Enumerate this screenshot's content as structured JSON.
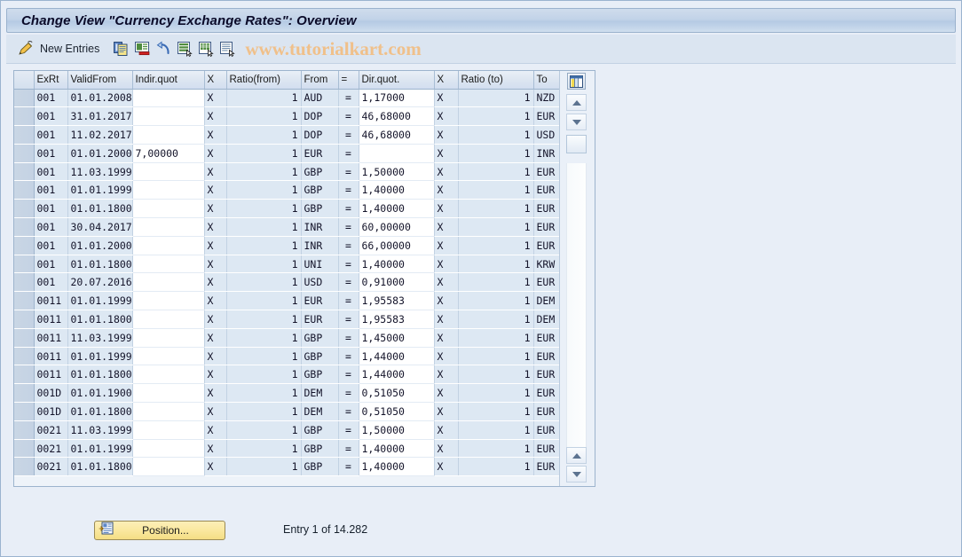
{
  "window": {
    "title": "Change View \"Currency Exchange Rates\": Overview"
  },
  "toolbar": {
    "pencil_icon": "pencil-icon",
    "new_entries_label": "New Entries",
    "buttons": [
      {
        "name": "copy-as-icon",
        "title": "Copy As..."
      },
      {
        "name": "delete-icon",
        "title": "Delete"
      },
      {
        "name": "undo-icon",
        "title": "Undo Change"
      },
      {
        "name": "select-all-icon",
        "title": "Select All"
      },
      {
        "name": "select-block-icon",
        "title": "Select Block"
      },
      {
        "name": "deselect-all-icon",
        "title": "Deselect All"
      }
    ],
    "watermark": "www.tutorialkart.com"
  },
  "grid": {
    "columns": [
      {
        "key": "exrt",
        "label": "ExRt"
      },
      {
        "key": "valid",
        "label": "ValidFrom"
      },
      {
        "key": "indir",
        "label": "Indir.quot"
      },
      {
        "key": "x1",
        "label": "X"
      },
      {
        "key": "rfrom",
        "label": "Ratio(from)"
      },
      {
        "key": "from",
        "label": "From"
      },
      {
        "key": "eq",
        "label": "="
      },
      {
        "key": "dir",
        "label": "Dir.quot."
      },
      {
        "key": "x2",
        "label": "X"
      },
      {
        "key": "rto",
        "label": "Ratio (to)"
      },
      {
        "key": "to",
        "label": "To"
      }
    ],
    "column_config_icon": "table-settings-icon",
    "rows": [
      {
        "exrt": "001",
        "valid": "01.01.2008",
        "indir": "",
        "indir_red": false,
        "x1": "X",
        "rfrom": "1",
        "from": "AUD",
        "eq": "=",
        "dir": "1,17000",
        "x2": "X",
        "rto": "1",
        "to": "NZD"
      },
      {
        "exrt": "001",
        "valid": "31.01.2017",
        "indir": "",
        "indir_red": false,
        "x1": "X",
        "rfrom": "1",
        "from": "DOP",
        "eq": "=",
        "dir": "46,68000",
        "x2": "X",
        "rto": "1",
        "to": "EUR"
      },
      {
        "exrt": "001",
        "valid": "11.02.2017",
        "indir": "",
        "indir_red": false,
        "x1": "X",
        "rfrom": "1",
        "from": "DOP",
        "eq": "=",
        "dir": "46,68000",
        "x2": "X",
        "rto": "1",
        "to": "USD"
      },
      {
        "exrt": "001",
        "valid": "01.01.2000",
        "indir": "7,00000",
        "indir_red": true,
        "x1": "X",
        "rfrom": "1",
        "from": "EUR",
        "eq": "=",
        "dir": "",
        "x2": "X",
        "rto": "1",
        "to": "INR"
      },
      {
        "exrt": "001",
        "valid": "11.03.1999",
        "indir": "",
        "indir_red": false,
        "x1": "X",
        "rfrom": "1",
        "from": "GBP",
        "eq": "=",
        "dir": "1,50000",
        "x2": "X",
        "rto": "1",
        "to": "EUR"
      },
      {
        "exrt": "001",
        "valid": "01.01.1999",
        "indir": "",
        "indir_red": false,
        "x1": "X",
        "rfrom": "1",
        "from": "GBP",
        "eq": "=",
        "dir": "1,40000",
        "x2": "X",
        "rto": "1",
        "to": "EUR"
      },
      {
        "exrt": "001",
        "valid": "01.01.1800",
        "indir": "",
        "indir_red": false,
        "x1": "X",
        "rfrom": "1",
        "from": "GBP",
        "eq": "=",
        "dir": "1,40000",
        "x2": "X",
        "rto": "1",
        "to": "EUR"
      },
      {
        "exrt": "001",
        "valid": "30.04.2017",
        "indir": "",
        "indir_red": false,
        "x1": "X",
        "rfrom": "1",
        "from": "INR",
        "eq": "=",
        "dir": "60,00000",
        "x2": "X",
        "rto": "1",
        "to": "EUR"
      },
      {
        "exrt": "001",
        "valid": "01.01.2000",
        "indir": "",
        "indir_red": false,
        "x1": "X",
        "rfrom": "1",
        "from": "INR",
        "eq": "=",
        "dir": "66,00000",
        "x2": "X",
        "rto": "1",
        "to": "EUR"
      },
      {
        "exrt": "001",
        "valid": "01.01.1800",
        "indir": "",
        "indir_red": false,
        "x1": "X",
        "rfrom": "1",
        "from": "UNI",
        "eq": "=",
        "dir": "1,40000",
        "x2": "X",
        "rto": "1",
        "to": "KRW"
      },
      {
        "exrt": "001",
        "valid": "20.07.2016",
        "indir": "",
        "indir_red": false,
        "x1": "X",
        "rfrom": "1",
        "from": "USD",
        "eq": "=",
        "dir": "0,91000",
        "x2": "X",
        "rto": "1",
        "to": "EUR"
      },
      {
        "exrt": "0011",
        "valid": "01.01.1999",
        "indir": "",
        "indir_red": false,
        "x1": "X",
        "rfrom": "1",
        "from": "EUR",
        "eq": "=",
        "dir": "1,95583",
        "x2": "X",
        "rto": "1",
        "to": "DEM"
      },
      {
        "exrt": "0011",
        "valid": "01.01.1800",
        "indir": "",
        "indir_red": false,
        "x1": "X",
        "rfrom": "1",
        "from": "EUR",
        "eq": "=",
        "dir": "1,95583",
        "x2": "X",
        "rto": "1",
        "to": "DEM"
      },
      {
        "exrt": "0011",
        "valid": "11.03.1999",
        "indir": "",
        "indir_red": false,
        "x1": "X",
        "rfrom": "1",
        "from": "GBP",
        "eq": "=",
        "dir": "1,45000",
        "x2": "X",
        "rto": "1",
        "to": "EUR"
      },
      {
        "exrt": "0011",
        "valid": "01.01.1999",
        "indir": "",
        "indir_red": false,
        "x1": "X",
        "rfrom": "1",
        "from": "GBP",
        "eq": "=",
        "dir": "1,44000",
        "x2": "X",
        "rto": "1",
        "to": "EUR"
      },
      {
        "exrt": "0011",
        "valid": "01.01.1800",
        "indir": "",
        "indir_red": false,
        "x1": "X",
        "rfrom": "1",
        "from": "GBP",
        "eq": "=",
        "dir": "1,44000",
        "x2": "X",
        "rto": "1",
        "to": "EUR"
      },
      {
        "exrt": "001D",
        "valid": "01.01.1900",
        "indir": "",
        "indir_red": false,
        "x1": "X",
        "rfrom": "1",
        "from": "DEM",
        "eq": "=",
        "dir": "0,51050",
        "x2": "X",
        "rto": "1",
        "to": "EUR"
      },
      {
        "exrt": "001D",
        "valid": "01.01.1800",
        "indir": "",
        "indir_red": false,
        "x1": "X",
        "rfrom": "1",
        "from": "DEM",
        "eq": "=",
        "dir": "0,51050",
        "x2": "X",
        "rto": "1",
        "to": "EUR"
      },
      {
        "exrt": "0021",
        "valid": "11.03.1999",
        "indir": "",
        "indir_red": false,
        "x1": "X",
        "rfrom": "1",
        "from": "GBP",
        "eq": "=",
        "dir": "1,50000",
        "x2": "X",
        "rto": "1",
        "to": "EUR"
      },
      {
        "exrt": "0021",
        "valid": "01.01.1999",
        "indir": "",
        "indir_red": false,
        "x1": "X",
        "rfrom": "1",
        "from": "GBP",
        "eq": "=",
        "dir": "1,40000",
        "x2": "X",
        "rto": "1",
        "to": "EUR"
      },
      {
        "exrt": "0021",
        "valid": "01.01.1800",
        "indir": "",
        "indir_red": false,
        "x1": "X",
        "rfrom": "1",
        "from": "GBP",
        "eq": "=",
        "dir": "1,40000",
        "x2": "X",
        "rto": "1",
        "to": "EUR"
      }
    ]
  },
  "footer": {
    "position_button_label": "Position...",
    "position_button_icon": "position-icon",
    "entry_status": "Entry 1 of 14.282"
  },
  "colors": {
    "title_bar": "#c2d3e8",
    "toolbar": "#dbe5f1",
    "row_bg": "#dde8f3",
    "input_bg": "#ffffff",
    "red_value": "#b51a1a",
    "button_yellow": "#f7e49a",
    "watermark": "#f0c08a"
  }
}
